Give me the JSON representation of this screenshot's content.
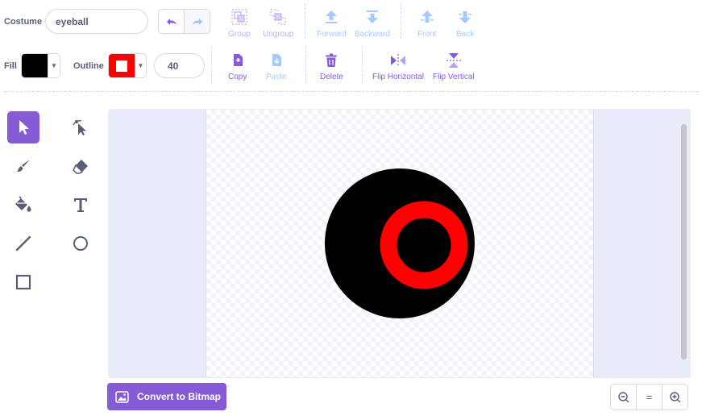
{
  "costume": {
    "label": "Costume",
    "name": "eyeball"
  },
  "toolbar": {
    "group": "Group",
    "ungroup": "Ungroup",
    "forward": "Forward",
    "backward": "Backward",
    "front": "Front",
    "back": "Back",
    "copy": "Copy",
    "paste": "Paste",
    "delete": "Delete",
    "flip_horizontal": "Flip Horizontal",
    "flip_vertical": "Flip Vertical"
  },
  "style": {
    "fill_label": "Fill",
    "fill_color": "#000000",
    "outline_label": "Outline",
    "outline_color": "#ff0000",
    "outline_width": "40"
  },
  "tools": [
    "select",
    "reshape",
    "brush",
    "eraser",
    "fill",
    "text",
    "line",
    "circle",
    "rectangle"
  ],
  "active_tool": "select",
  "convert_button": "Convert to Bitmap",
  "zoom": {
    "out": "zoom-out-icon",
    "reset": "=",
    "in": "zoom-in-icon"
  },
  "colors": {
    "accent": "#855cd6",
    "blue": "#4c97ff",
    "text": "#575e75"
  }
}
